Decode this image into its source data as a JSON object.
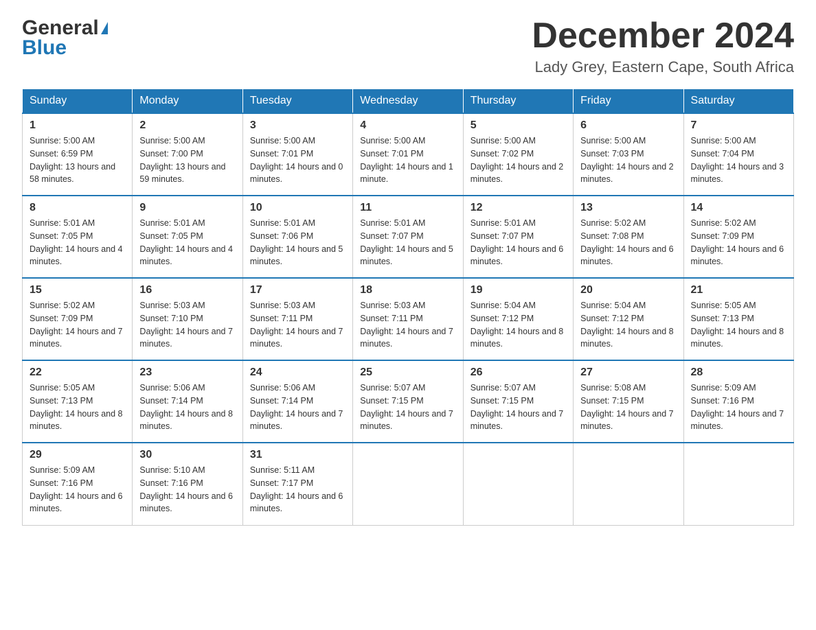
{
  "header": {
    "logo_general": "General",
    "logo_blue": "Blue",
    "month_title": "December 2024",
    "location": "Lady Grey, Eastern Cape, South Africa"
  },
  "days_of_week": [
    "Sunday",
    "Monday",
    "Tuesday",
    "Wednesday",
    "Thursday",
    "Friday",
    "Saturday"
  ],
  "weeks": [
    [
      {
        "num": "1",
        "sunrise": "5:00 AM",
        "sunset": "6:59 PM",
        "daylight": "13 hours and 58 minutes."
      },
      {
        "num": "2",
        "sunrise": "5:00 AM",
        "sunset": "7:00 PM",
        "daylight": "13 hours and 59 minutes."
      },
      {
        "num": "3",
        "sunrise": "5:00 AM",
        "sunset": "7:01 PM",
        "daylight": "14 hours and 0 minutes."
      },
      {
        "num": "4",
        "sunrise": "5:00 AM",
        "sunset": "7:01 PM",
        "daylight": "14 hours and 1 minute."
      },
      {
        "num": "5",
        "sunrise": "5:00 AM",
        "sunset": "7:02 PM",
        "daylight": "14 hours and 2 minutes."
      },
      {
        "num": "6",
        "sunrise": "5:00 AM",
        "sunset": "7:03 PM",
        "daylight": "14 hours and 2 minutes."
      },
      {
        "num": "7",
        "sunrise": "5:00 AM",
        "sunset": "7:04 PM",
        "daylight": "14 hours and 3 minutes."
      }
    ],
    [
      {
        "num": "8",
        "sunrise": "5:01 AM",
        "sunset": "7:05 PM",
        "daylight": "14 hours and 4 minutes."
      },
      {
        "num": "9",
        "sunrise": "5:01 AM",
        "sunset": "7:05 PM",
        "daylight": "14 hours and 4 minutes."
      },
      {
        "num": "10",
        "sunrise": "5:01 AM",
        "sunset": "7:06 PM",
        "daylight": "14 hours and 5 minutes."
      },
      {
        "num": "11",
        "sunrise": "5:01 AM",
        "sunset": "7:07 PM",
        "daylight": "14 hours and 5 minutes."
      },
      {
        "num": "12",
        "sunrise": "5:01 AM",
        "sunset": "7:07 PM",
        "daylight": "14 hours and 6 minutes."
      },
      {
        "num": "13",
        "sunrise": "5:02 AM",
        "sunset": "7:08 PM",
        "daylight": "14 hours and 6 minutes."
      },
      {
        "num": "14",
        "sunrise": "5:02 AM",
        "sunset": "7:09 PM",
        "daylight": "14 hours and 6 minutes."
      }
    ],
    [
      {
        "num": "15",
        "sunrise": "5:02 AM",
        "sunset": "7:09 PM",
        "daylight": "14 hours and 7 minutes."
      },
      {
        "num": "16",
        "sunrise": "5:03 AM",
        "sunset": "7:10 PM",
        "daylight": "14 hours and 7 minutes."
      },
      {
        "num": "17",
        "sunrise": "5:03 AM",
        "sunset": "7:11 PM",
        "daylight": "14 hours and 7 minutes."
      },
      {
        "num": "18",
        "sunrise": "5:03 AM",
        "sunset": "7:11 PM",
        "daylight": "14 hours and 7 minutes."
      },
      {
        "num": "19",
        "sunrise": "5:04 AM",
        "sunset": "7:12 PM",
        "daylight": "14 hours and 8 minutes."
      },
      {
        "num": "20",
        "sunrise": "5:04 AM",
        "sunset": "7:12 PM",
        "daylight": "14 hours and 8 minutes."
      },
      {
        "num": "21",
        "sunrise": "5:05 AM",
        "sunset": "7:13 PM",
        "daylight": "14 hours and 8 minutes."
      }
    ],
    [
      {
        "num": "22",
        "sunrise": "5:05 AM",
        "sunset": "7:13 PM",
        "daylight": "14 hours and 8 minutes."
      },
      {
        "num": "23",
        "sunrise": "5:06 AM",
        "sunset": "7:14 PM",
        "daylight": "14 hours and 8 minutes."
      },
      {
        "num": "24",
        "sunrise": "5:06 AM",
        "sunset": "7:14 PM",
        "daylight": "14 hours and 7 minutes."
      },
      {
        "num": "25",
        "sunrise": "5:07 AM",
        "sunset": "7:15 PM",
        "daylight": "14 hours and 7 minutes."
      },
      {
        "num": "26",
        "sunrise": "5:07 AM",
        "sunset": "7:15 PM",
        "daylight": "14 hours and 7 minutes."
      },
      {
        "num": "27",
        "sunrise": "5:08 AM",
        "sunset": "7:15 PM",
        "daylight": "14 hours and 7 minutes."
      },
      {
        "num": "28",
        "sunrise": "5:09 AM",
        "sunset": "7:16 PM",
        "daylight": "14 hours and 7 minutes."
      }
    ],
    [
      {
        "num": "29",
        "sunrise": "5:09 AM",
        "sunset": "7:16 PM",
        "daylight": "14 hours and 6 minutes."
      },
      {
        "num": "30",
        "sunrise": "5:10 AM",
        "sunset": "7:16 PM",
        "daylight": "14 hours and 6 minutes."
      },
      {
        "num": "31",
        "sunrise": "5:11 AM",
        "sunset": "7:17 PM",
        "daylight": "14 hours and 6 minutes."
      },
      null,
      null,
      null,
      null
    ]
  ]
}
